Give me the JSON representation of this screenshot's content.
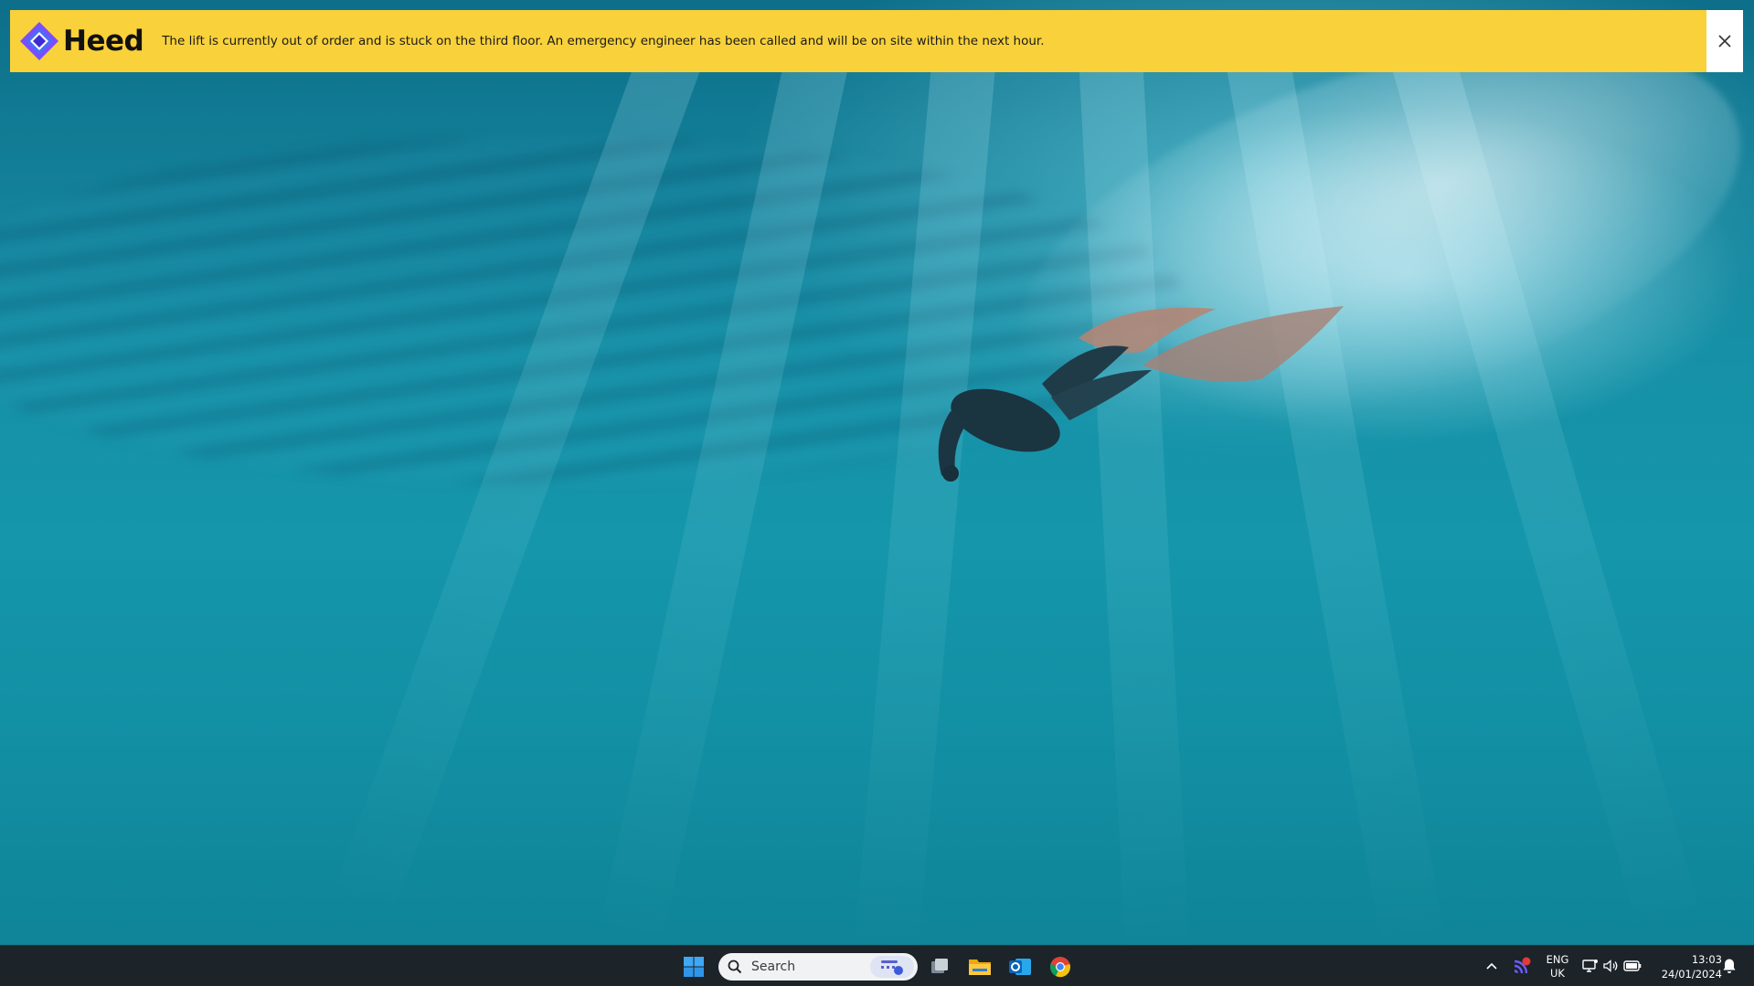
{
  "notification": {
    "brand_name": "Heed",
    "message": "The lift is currently out of order and is stuck on the third floor. An emergency engineer has been called and will be on site within the next hour.",
    "background_color": "#f9d13a",
    "close_icon": "close-icon"
  },
  "wallpaper": {
    "subject": "underwater-diver"
  },
  "taskbar": {
    "search": {
      "label": "Search",
      "icon": "search-icon"
    },
    "pinned_apps": [
      {
        "name": "start",
        "icon": "windows-logo-icon"
      },
      {
        "name": "task-view",
        "icon": "task-view-icon"
      },
      {
        "name": "file-explorer",
        "icon": "folder-icon"
      },
      {
        "name": "outlook",
        "icon": "outlook-icon"
      },
      {
        "name": "chrome",
        "icon": "chrome-icon"
      }
    ],
    "tray": {
      "language_line1": "ENG",
      "language_line2": "UK",
      "time": "13:03",
      "date": "24/01/2024"
    }
  }
}
